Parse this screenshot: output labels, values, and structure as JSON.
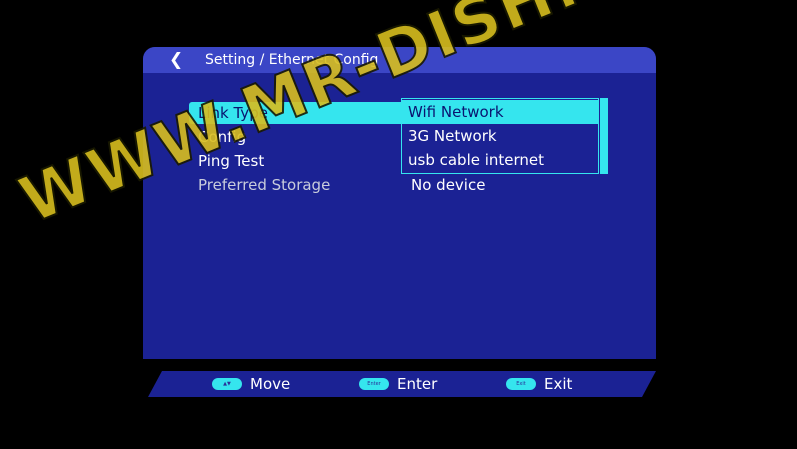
{
  "header": {
    "back_icon": "chevron-left-icon",
    "title": "Setting / Ethernet Config"
  },
  "menu": {
    "items": [
      {
        "label": "Link Type",
        "selected": true
      },
      {
        "label": "Config"
      },
      {
        "label": "Ping Test"
      },
      {
        "label": "Preferred Storage",
        "value": "No device"
      }
    ]
  },
  "dropdown": {
    "options": [
      "Wifi Network",
      "3G Network",
      "usb cable internet"
    ],
    "selected_index": 0
  },
  "footer": {
    "hints": [
      {
        "key": "▲▼",
        "label": "Move"
      },
      {
        "key": "Enter",
        "label": "Enter"
      },
      {
        "key": "Exit",
        "label": "Exit"
      }
    ]
  },
  "watermark": "WWW.MR-DISH.COM",
  "colors": {
    "panel": "#1b2294",
    "titlebar": "#3b46c6",
    "highlight": "#35e5ee",
    "watermark": "#d8be1e"
  }
}
